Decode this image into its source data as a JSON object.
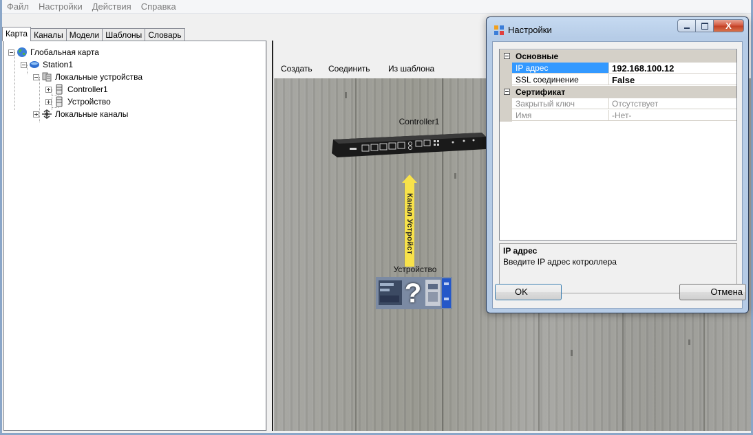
{
  "menu": [
    "Файл",
    "Настройки",
    "Действия",
    "Справка"
  ],
  "tabs": [
    {
      "label": "Карта",
      "active": true
    },
    {
      "label": "Каналы",
      "active": false
    },
    {
      "label": "Модели",
      "active": false
    },
    {
      "label": "Шаблоны",
      "active": false
    },
    {
      "label": "Словарь",
      "active": false
    }
  ],
  "tree": {
    "root": {
      "label": "Глобальная карта",
      "icon": "globe-icon"
    },
    "station": {
      "label": "Station1",
      "icon": "station-icon"
    },
    "local_devices": {
      "label": "Локальные устройства",
      "icon": "devices-folder-icon"
    },
    "controller": {
      "label": "Controller1",
      "icon": "database-icon"
    },
    "device": {
      "label": "Устройство",
      "icon": "database-icon"
    },
    "local_channels": {
      "label": "Локальные каналы",
      "icon": "network-channels-icon"
    }
  },
  "map": {
    "toolbar": {
      "create": "Создать",
      "connect": "Соединить",
      "from_template": "Из шаблона"
    },
    "controller_label": "Controller1",
    "channel_label": "Канал Устройст",
    "device_label": "Устройство",
    "device_icon": "unknown-device-icon"
  },
  "dialog": {
    "title": "Настройки",
    "close_glyph": "X",
    "categories": [
      {
        "label": "Основные",
        "rows": [
          {
            "name": "IP адрес",
            "value": "192.168.100.12",
            "selected": true,
            "bold": true,
            "readonly": false
          },
          {
            "name": "SSL соединение",
            "value": "False",
            "selected": false,
            "bold": true,
            "readonly": false
          }
        ]
      },
      {
        "label": "Сертификат",
        "rows": [
          {
            "name": "Закрытый ключ",
            "value": "Отсутствует",
            "selected": false,
            "bold": false,
            "readonly": true
          },
          {
            "name": "Имя",
            "value": "-Нет-",
            "selected": false,
            "bold": false,
            "readonly": true
          }
        ]
      }
    ],
    "help": {
      "title": "IP адрес",
      "description": "Введите IP адрес котроллера"
    },
    "ok": "OK",
    "cancel": "Отмена"
  },
  "colors": {
    "selection": "#3399ff",
    "link": "#f8e24a",
    "close_button": "#c23f24"
  }
}
